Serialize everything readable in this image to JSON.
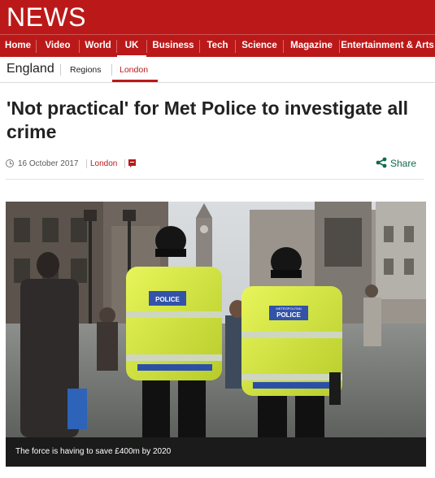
{
  "brand": {
    "logo_text": "NEWS",
    "accent": "#bb1919"
  },
  "main_nav": {
    "items": [
      {
        "label": "Home"
      },
      {
        "label": "Video"
      },
      {
        "label": "World"
      },
      {
        "label": "UK",
        "active": true
      },
      {
        "label": "Business"
      },
      {
        "label": "Tech"
      },
      {
        "label": "Science"
      },
      {
        "label": "Magazine"
      },
      {
        "label": "Entertainment & Arts"
      }
    ]
  },
  "sub_nav": {
    "section": "England",
    "links": [
      {
        "label": "Regions"
      },
      {
        "label": "London",
        "active": true
      }
    ]
  },
  "article": {
    "headline": "'Not practical' for Met Police to investigate all crime",
    "date": "16 October 2017",
    "location": "London",
    "share_label": "Share",
    "image_caption": "The force is having to save £400m by 2020",
    "image_badge_text": "POLICE",
    "image_badge_small": "METROPOLITAN"
  },
  "icons": {
    "clock": "clock-icon",
    "comment": "comment-icon",
    "share": "share-icon"
  }
}
